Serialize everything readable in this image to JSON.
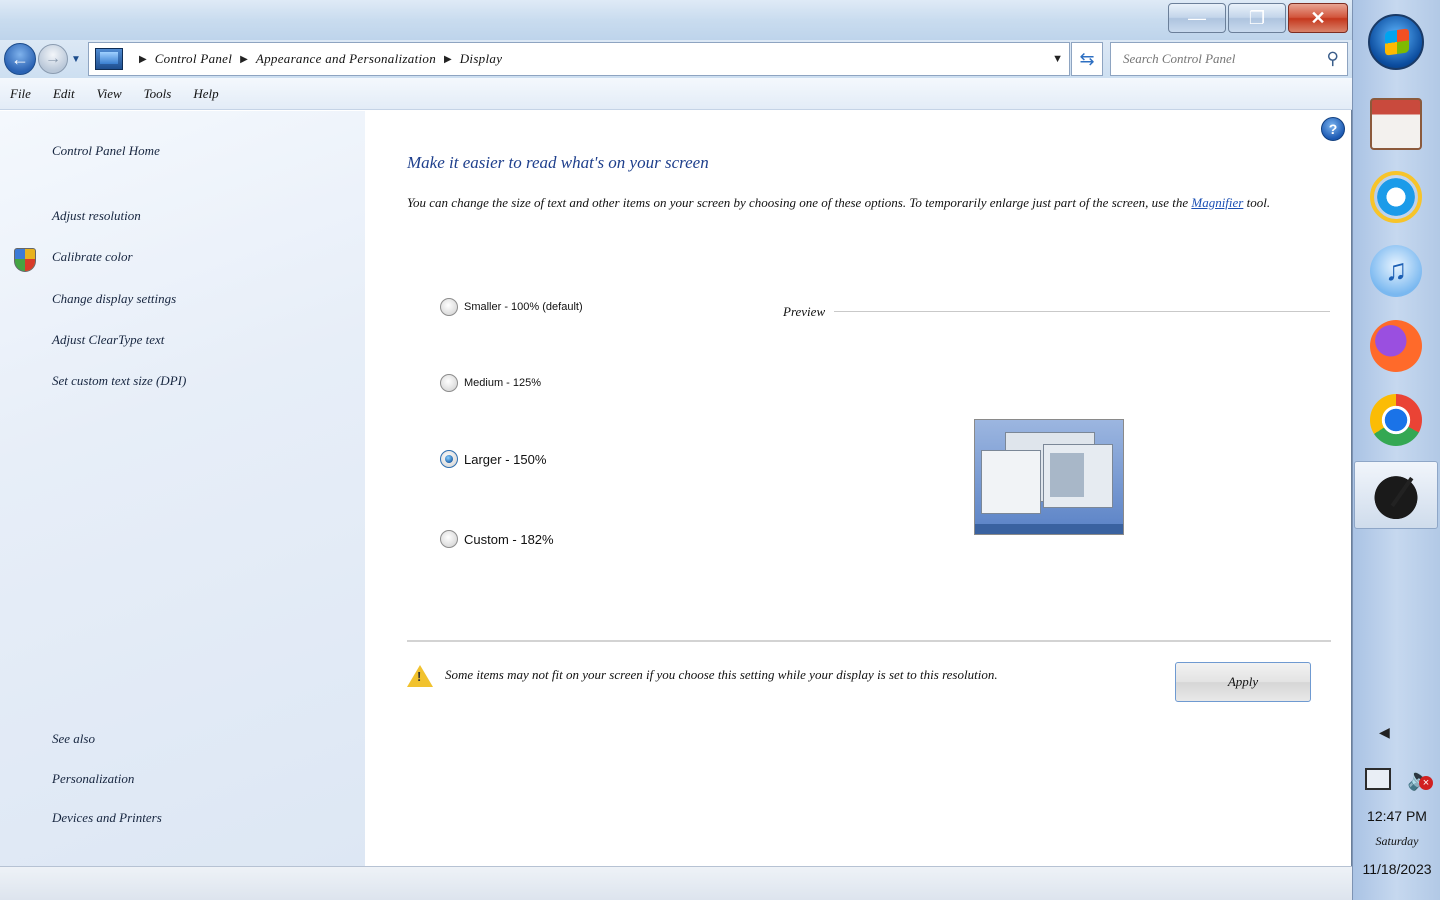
{
  "window": {
    "caption": {
      "minimize": "—",
      "maximize": "❐",
      "close": "✕"
    }
  },
  "navbar": {
    "breadcrumbs": [
      "Control Panel",
      "Appearance and Personalization",
      "Display"
    ],
    "search_placeholder": "Search Control Panel"
  },
  "menubar": {
    "items": [
      "File",
      "Edit",
      "View",
      "Tools",
      "Help"
    ]
  },
  "leftpane": {
    "links": [
      "Control Panel Home",
      "Adjust resolution",
      "Calibrate color",
      "Change display settings",
      "Adjust ClearType text",
      "Set custom text size (DPI)"
    ],
    "see_also": "See also",
    "bottom_links": [
      "Personalization",
      "Devices and Printers"
    ]
  },
  "main": {
    "heading": "Make it easier to read what's on your screen",
    "description": "You can change the size of text and other items on your screen by choosing one of these options. To temporarily enlarge just part of the screen, use the",
    "description_link": "Magnifier",
    "description_end": "tool.",
    "options": [
      {
        "name": "Smaller",
        "label": "Smaller - 100% (default)",
        "checked": false
      },
      {
        "name": "Medium",
        "label": "Medium - 125%",
        "checked": false
      },
      {
        "name": "Larger",
        "label": "Larger - 150%",
        "checked": true
      },
      {
        "name": "Custom",
        "label": "Custom - 182%",
        "checked": false
      }
    ],
    "preview_label": "Preview",
    "warning": "Some items may not fit on your screen if you choose this setting while your display is set to this resolution.",
    "apply_label": "Apply"
  },
  "taskbar": {
    "apps": [
      "store",
      "internet-explorer",
      "itunes",
      "firefox",
      "chrome",
      "ink-app"
    ],
    "time": "12:47 PM",
    "day": "Saturday",
    "date": "11/18/2023"
  }
}
